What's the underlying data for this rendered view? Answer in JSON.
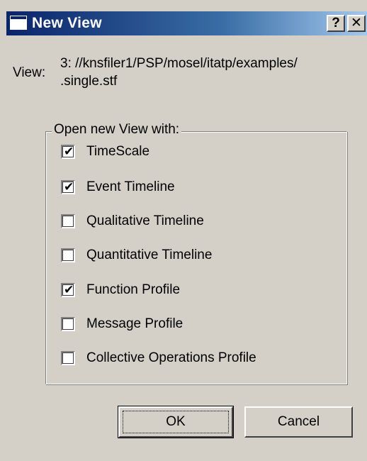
{
  "window": {
    "title": "New View",
    "help_glyph": "?",
    "close_glyph": "✕"
  },
  "view": {
    "label": "View:",
    "path_line1": "3: //knsfiler1/PSP/mosel/itatp/examples/",
    "path_line2": ".single.stf"
  },
  "group": {
    "legend": "Open new View with:",
    "options": [
      {
        "label": "TimeScale",
        "checked": true
      },
      {
        "label": "Event Timeline",
        "checked": true
      },
      {
        "label": "Qualitative Timeline",
        "checked": false
      },
      {
        "label": "Quantitative Timeline",
        "checked": false
      },
      {
        "label": "Function Profile",
        "checked": true
      },
      {
        "label": "Message Profile",
        "checked": false
      },
      {
        "label": "Collective Operations Profile",
        "checked": false
      }
    ],
    "check_glyph": "✔"
  },
  "buttons": {
    "ok": "OK",
    "cancel": "Cancel"
  }
}
